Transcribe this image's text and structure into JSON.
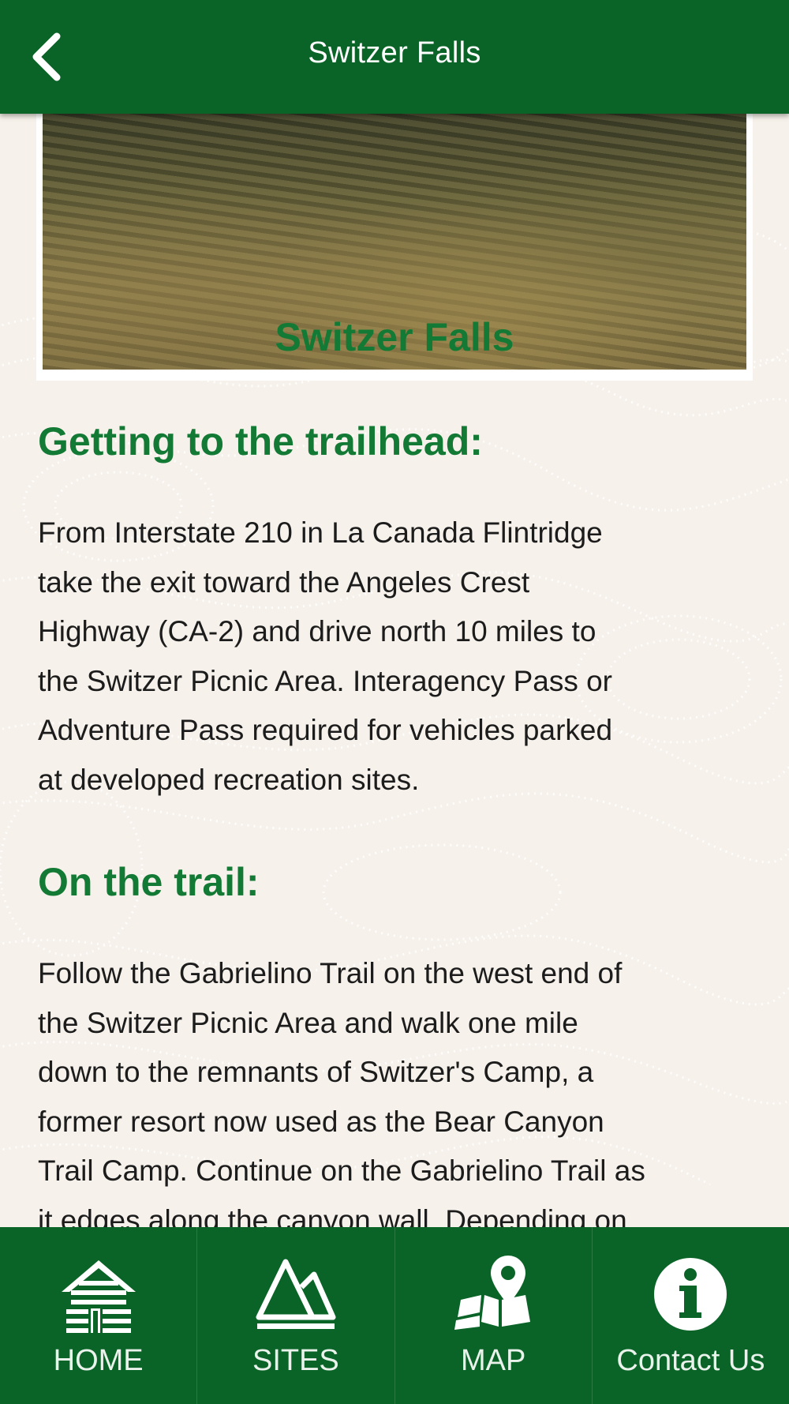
{
  "header": {
    "title": "Switzer Falls",
    "back_icon": "chevron-left-icon"
  },
  "hero_image": {
    "description_icon": "creek-photo"
  },
  "article": {
    "title": "Switzer Falls",
    "sections": [
      {
        "heading": "Getting to the trailhead:",
        "lines": [
          "From Interstate 210 in La Canada Flintridge",
          "take the exit toward the Angeles Crest",
          "Highway (CA-2) and drive north 10 miles to",
          "the Switzer Picnic Area. Interagency Pass or",
          "Adventure Pass required for vehicles parked",
          "at developed recreation sites."
        ]
      },
      {
        "heading": "On the trail:",
        "lines": [
          "Follow the Gabrielino Trail on the west end of",
          "the Switzer Picnic Area and walk one mile",
          "down to the remnants of Switzer's Camp, a",
          "former resort now used as the Bear Canyon",
          "Trail Camp. Continue on the Gabrielino Trail as",
          "it edges along the canyon wall. Depending on"
        ]
      }
    ]
  },
  "tabs": [
    {
      "label": "HOME",
      "icon": "cabin-icon"
    },
    {
      "label": "SITES",
      "icon": "mountains-icon"
    },
    {
      "label": "MAP",
      "icon": "map-pin-icon"
    },
    {
      "label": "Contact Us",
      "icon": "info-icon"
    }
  ],
  "colors": {
    "header_green": "#0a6327",
    "heading_green": "#127a34",
    "background": "#f6f1ea"
  }
}
